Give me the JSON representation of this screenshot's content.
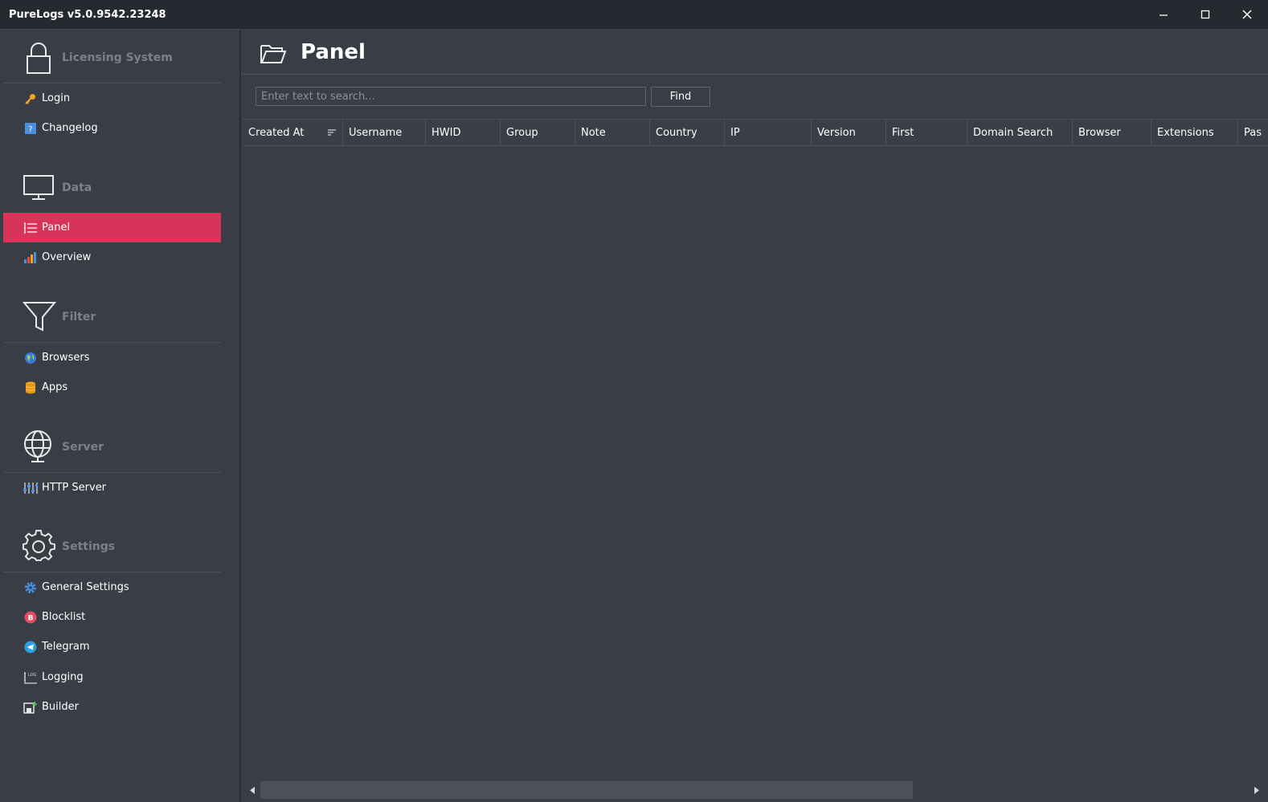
{
  "window": {
    "title": "PureLogs v5.0.9542.23248"
  },
  "sidebar": {
    "groups": [
      {
        "label": "Licensing System",
        "icon": "lock-icon",
        "items": [
          {
            "label": "Login",
            "icon": "key-icon"
          },
          {
            "label": "Changelog",
            "icon": "help-book-icon"
          }
        ]
      },
      {
        "label": "Data",
        "icon": "monitor-icon",
        "items": [
          {
            "label": "Panel",
            "icon": "list-icon",
            "active": true
          },
          {
            "label": "Overview",
            "icon": "bar-chart-icon"
          }
        ]
      },
      {
        "label": "Filter",
        "icon": "funnel-icon",
        "items": [
          {
            "label": "Browsers",
            "icon": "globe-icon"
          },
          {
            "label": "Apps",
            "icon": "database-icon"
          }
        ]
      },
      {
        "label": "Server",
        "icon": "globe-server-icon",
        "items": [
          {
            "label": "HTTP Server",
            "icon": "sliders-icon"
          }
        ]
      },
      {
        "label": "Settings",
        "icon": "gear-icon",
        "items": [
          {
            "label": "General Settings",
            "icon": "gear-small-icon"
          },
          {
            "label": "Blocklist",
            "icon": "block-b-icon"
          },
          {
            "label": "Telegram",
            "icon": "telegram-icon"
          },
          {
            "label": "Logging",
            "icon": "log-icon"
          },
          {
            "label": "Builder",
            "icon": "builder-icon"
          }
        ]
      }
    ]
  },
  "main": {
    "title": "Panel",
    "search": {
      "placeholder": "Enter text to search...",
      "value": ""
    },
    "find_label": "Find",
    "columns": [
      "Created At",
      "Username",
      "HWID",
      "Group",
      "Note",
      "Country",
      "IP",
      "Version",
      "First",
      "Domain Search",
      "Browser",
      "Extensions",
      "Pas"
    ]
  },
  "colors": {
    "accent": "#d8345a",
    "background": "#393e46",
    "titlebar": "#262a30"
  }
}
